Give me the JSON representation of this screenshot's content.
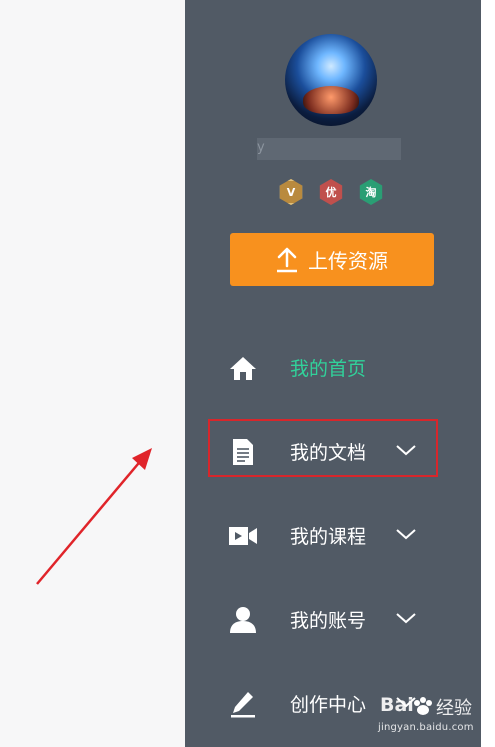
{
  "profile": {
    "username": "y",
    "badges": [
      {
        "label": "V",
        "color": "#b98a3e"
      },
      {
        "label": "优",
        "color": "#c0504d"
      },
      {
        "label": "淘",
        "color": "#2a9e74"
      }
    ]
  },
  "upload": {
    "label": "上传资源",
    "color": "#f8911e"
  },
  "nav": {
    "items": [
      {
        "label": "我的首页",
        "icon": "home-icon",
        "active": true,
        "has_chevron": false
      },
      {
        "label": "我的文档",
        "icon": "document-icon",
        "active": false,
        "has_chevron": true,
        "highlighted": true
      },
      {
        "label": "我的课程",
        "icon": "video-camera-icon",
        "active": false,
        "has_chevron": true
      },
      {
        "label": "我的账号",
        "icon": "user-icon",
        "active": false,
        "has_chevron": true
      },
      {
        "label": "创作中心",
        "icon": "pencil-icon",
        "active": false,
        "has_chevron": true
      }
    ]
  },
  "colors": {
    "sidebar_bg": "#515a65",
    "active_text": "#31d19a",
    "highlight_border": "#d8262b",
    "arrow": "#e0242a"
  },
  "watermark": {
    "brand": "Bai",
    "brand_suffix": "经验",
    "url": "jingyan.baidu.com"
  }
}
